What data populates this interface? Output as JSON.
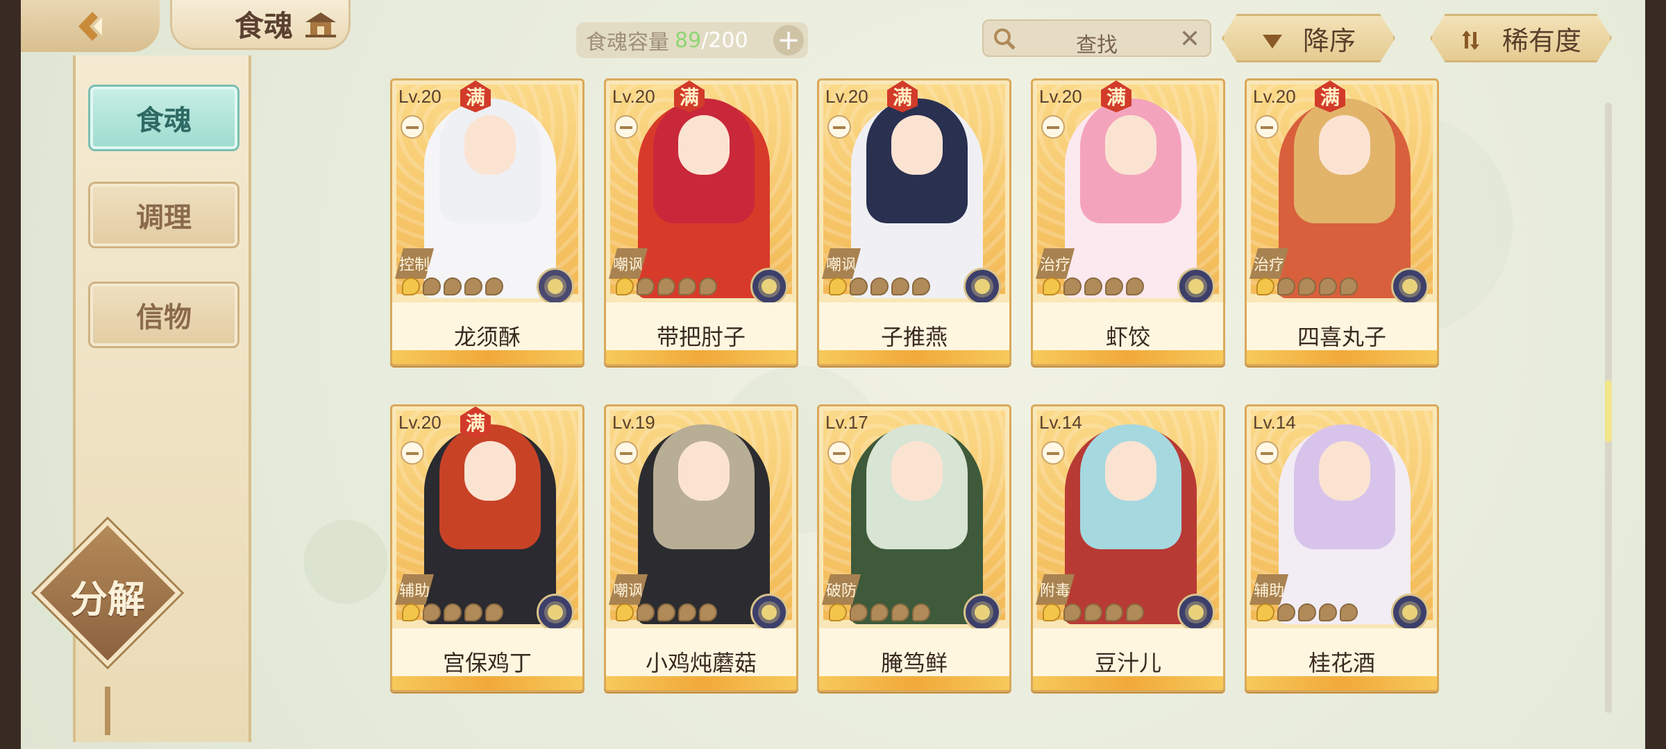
{
  "header": {
    "title": "食魂",
    "capacity_label": "食魂容量",
    "capacity_used": "89",
    "capacity_sep": "/",
    "capacity_max": "200",
    "add_label": "+"
  },
  "search": {
    "placeholder": "查找",
    "clear_label": "✕"
  },
  "sort": {
    "order_label": "降序",
    "rarity_label": "稀有度"
  },
  "sidebar": {
    "items": [
      {
        "label": "食魂",
        "active": true
      },
      {
        "label": "调理",
        "active": false
      },
      {
        "label": "信物",
        "active": false
      }
    ],
    "decompose_label": "分解"
  },
  "full_badge": "满",
  "cards": [
    {
      "level": "Lv.20",
      "full": true,
      "role": "控制",
      "name": "龙须酥",
      "hair": "#eef0f4",
      "robe": "#f5f5f8",
      "element": "#4a4a70"
    },
    {
      "level": "Lv.20",
      "full": true,
      "role": "嘲讽",
      "name": "带把肘子",
      "hair": "#c8283a",
      "robe": "#d83a2a",
      "element": "#3d3f6b"
    },
    {
      "level": "Lv.20",
      "full": true,
      "role": "嘲讽",
      "name": "子推燕",
      "hair": "#2a3050",
      "robe": "#f0f0f4",
      "element": "#3d3f6b"
    },
    {
      "level": "Lv.20",
      "full": true,
      "role": "治疗",
      "name": "虾饺",
      "hair": "#f3a4bc",
      "robe": "#fbe9ef",
      "element": "#3d3f6b"
    },
    {
      "level": "Lv.20",
      "full": true,
      "role": "治疗",
      "name": "四喜丸子",
      "hair": "#e2b46a",
      "robe": "#d8603c",
      "element": "#3d3f6b"
    },
    {
      "level": "Lv.20",
      "full": true,
      "role": "辅助",
      "name": "宫保鸡丁",
      "hair": "#c84226",
      "robe": "#2a2a30",
      "element": "#3d3f6b"
    },
    {
      "level": "Lv.19",
      "full": false,
      "role": "嘲讽",
      "name": "小鸡炖蘑菇",
      "hair": "#b8ad95",
      "robe": "#2c2c30",
      "element": "#3d3f6b"
    },
    {
      "level": "Lv.17",
      "full": false,
      "role": "破防",
      "name": "腌笃鲜",
      "hair": "#d8e4d4",
      "robe": "#3e5a3a",
      "element": "#3d3f6b"
    },
    {
      "level": "Lv.14",
      "full": false,
      "role": "附毒",
      "name": "豆汁儿",
      "hair": "#a6d8e0",
      "robe": "#b83a34",
      "element": "#3d3f6b"
    },
    {
      "level": "Lv.14",
      "full": false,
      "role": "辅助",
      "name": "桂花酒",
      "hair": "#d8c4ea",
      "robe": "#f2ecf4",
      "element": "#3d3f6b"
    }
  ]
}
